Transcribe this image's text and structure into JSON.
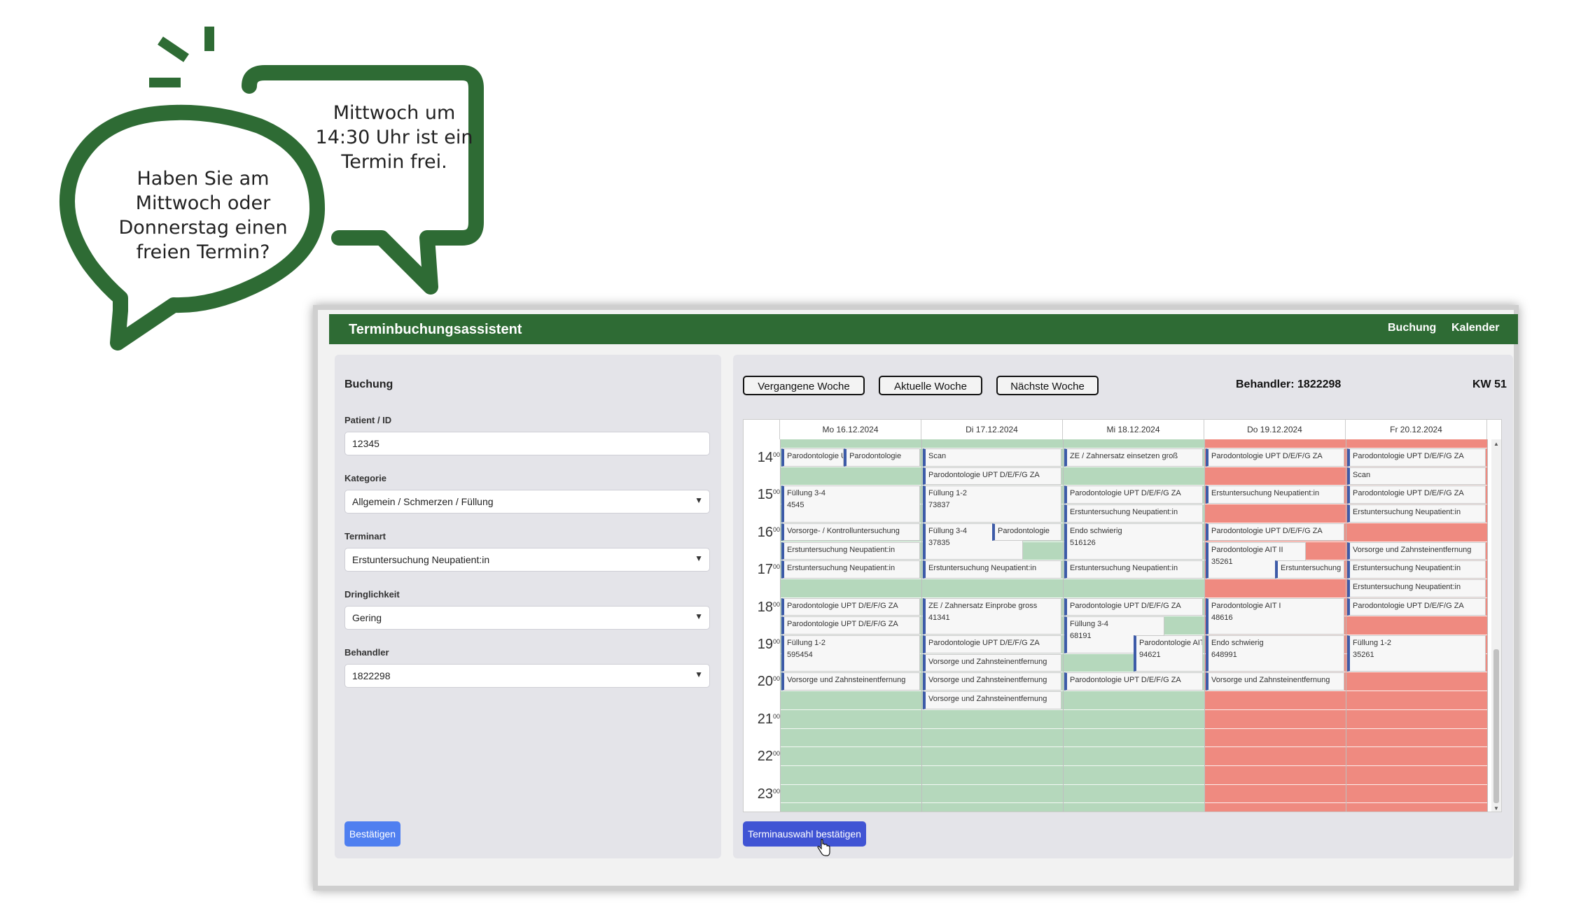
{
  "bubbles": {
    "question": "Haben Sie am Mittwoch oder Donnerstag einen freien Termin?",
    "answer": "Mittwoch um 14:30 Uhr ist ein Termin frei.",
    "color": "#2e6b34"
  },
  "navbar": {
    "title": "Terminbuchungsassistent",
    "links": [
      "Buchung",
      "Kalender"
    ],
    "color": "#2e6b34"
  },
  "booking": {
    "title": "Buchung",
    "fields": [
      {
        "label": "Patient / ID",
        "value": "12345",
        "type": "input"
      },
      {
        "label": "Kategorie",
        "value": "Allgemein / Schmerzen / Füllung",
        "type": "select"
      },
      {
        "label": "Terminart",
        "value": "Erstuntersuchung Neupatient:in",
        "type": "select"
      },
      {
        "label": "Dringlichkeit",
        "value": "Gering",
        "type": "select"
      },
      {
        "label": "Behandler",
        "value": "1822298",
        "type": "select"
      }
    ],
    "confirm": "Bestätigen"
  },
  "calendar": {
    "buttons": [
      "Vergangene Woche",
      "Aktuelle Woche",
      "Nächste Woche"
    ],
    "behandler": "Behandler: 1822298",
    "kw": "KW 51",
    "days": [
      "Mo 16.12.2024",
      "Di 17.12.2024",
      "Mi 18.12.2024",
      "Do 19.12.2024",
      "Fr 20.12.2024"
    ],
    "day_status": [
      "free",
      "free",
      "free",
      "busy",
      "busy"
    ],
    "hours": [
      "14",
      "15",
      "16",
      "17",
      "18",
      "19",
      "20",
      "21",
      "22",
      "23"
    ],
    "minute_sup": "00",
    "confirm": "Terminauswahl bestätigen",
    "events": [
      {
        "day": 0,
        "slot": 0,
        "span": 1,
        "sub": 0,
        "subw": 0.45,
        "text": "Parodontologie UPT D/E/F/G ZA",
        "sub2": ""
      },
      {
        "day": 0,
        "slot": 0,
        "span": 1,
        "sub": 0.45,
        "subw": 0.55,
        "text": "Parodontologie",
        "sub2": ""
      },
      {
        "day": 0,
        "slot": 2,
        "span": 2,
        "sub": 0,
        "subw": 1,
        "text": "Füllung 3-4",
        "sub2": "4545"
      },
      {
        "day": 0,
        "slot": 4,
        "span": 1,
        "sub": 0,
        "subw": 1,
        "text": "Vorsorge- / Kontrolluntersuchung",
        "sub2": ""
      },
      {
        "day": 0,
        "slot": 5,
        "span": 1,
        "sub": 0,
        "subw": 1,
        "text": "Erstuntersuchung Neupatient:in",
        "sub2": ""
      },
      {
        "day": 0,
        "slot": 6,
        "span": 1,
        "sub": 0,
        "subw": 1,
        "text": "Erstuntersuchung Neupatient:in",
        "sub2": ""
      },
      {
        "day": 0,
        "slot": 8,
        "span": 1,
        "sub": 0,
        "subw": 1,
        "text": "Parodontologie UPT D/E/F/G ZA",
        "sub2": ""
      },
      {
        "day": 0,
        "slot": 9,
        "span": 1,
        "sub": 0,
        "subw": 1,
        "text": "Parodontologie UPT D/E/F/G ZA",
        "sub2": ""
      },
      {
        "day": 0,
        "slot": 10,
        "span": 2,
        "sub": 0,
        "subw": 1,
        "text": "Füllung 1-2",
        "sub2": "595454"
      },
      {
        "day": 0,
        "slot": 12,
        "span": 1,
        "sub": 0,
        "subw": 1,
        "text": "Vorsorge und Zahnsteinentfernung",
        "sub2": ""
      },
      {
        "day": 1,
        "slot": 0,
        "span": 1,
        "sub": 0,
        "subw": 1,
        "text": "Scan",
        "sub2": ""
      },
      {
        "day": 1,
        "slot": 1,
        "span": 1,
        "sub": 0,
        "subw": 1,
        "text": "Parodontologie UPT D/E/F/G ZA",
        "sub2": ""
      },
      {
        "day": 1,
        "slot": 2,
        "span": 2,
        "sub": 0,
        "subw": 1,
        "text": "Füllung 1-2",
        "sub2": "73837"
      },
      {
        "day": 1,
        "slot": 4,
        "span": 2,
        "sub": 0,
        "subw": 0.72,
        "text": "Füllung 3-4",
        "sub2": "37835"
      },
      {
        "day": 1,
        "slot": 4,
        "span": 1,
        "sub": 0.5,
        "subw": 0.5,
        "text": "Parodontologie",
        "sub2": ""
      },
      {
        "day": 1,
        "slot": 6,
        "span": 1,
        "sub": 0,
        "subw": 1,
        "text": "Erstuntersuchung Neupatient:in",
        "sub2": ""
      },
      {
        "day": 1,
        "slot": 8,
        "span": 2,
        "sub": 0,
        "subw": 1,
        "text": "ZE / Zahnersatz Einprobe gross",
        "sub2": "41341"
      },
      {
        "day": 1,
        "slot": 10,
        "span": 1,
        "sub": 0,
        "subw": 1,
        "text": "Parodontologie UPT D/E/F/G ZA",
        "sub2": ""
      },
      {
        "day": 1,
        "slot": 11,
        "span": 1,
        "sub": 0,
        "subw": 1,
        "text": "Vorsorge und Zahnsteinentfernung",
        "sub2": ""
      },
      {
        "day": 1,
        "slot": 12,
        "span": 1,
        "sub": 0,
        "subw": 1,
        "text": "Vorsorge und Zahnsteinentfernung",
        "sub2": ""
      },
      {
        "day": 1,
        "slot": 13,
        "span": 1,
        "sub": 0,
        "subw": 1,
        "text": "Vorsorge und Zahnsteinentfernung",
        "sub2": ""
      },
      {
        "day": 2,
        "slot": 0,
        "span": 1,
        "sub": 0,
        "subw": 1,
        "text": "ZE / Zahnersatz einsetzen groß",
        "sub2": ""
      },
      {
        "day": 2,
        "slot": 2,
        "span": 1,
        "sub": 0,
        "subw": 1,
        "text": "Parodontologie UPT D/E/F/G ZA",
        "sub2": ""
      },
      {
        "day": 2,
        "slot": 3,
        "span": 1,
        "sub": 0,
        "subw": 1,
        "text": "Erstuntersuchung Neupatient:in",
        "sub2": ""
      },
      {
        "day": 2,
        "slot": 4,
        "span": 2,
        "sub": 0,
        "subw": 1,
        "text": "Endo schwierig",
        "sub2": "516126"
      },
      {
        "day": 2,
        "slot": 6,
        "span": 1,
        "sub": 0,
        "subw": 1,
        "text": "Erstuntersuchung Neupatient:in",
        "sub2": ""
      },
      {
        "day": 2,
        "slot": 8,
        "span": 1,
        "sub": 0,
        "subw": 1,
        "text": "Parodontologie UPT D/E/F/G ZA",
        "sub2": ""
      },
      {
        "day": 2,
        "slot": 9,
        "span": 2,
        "sub": 0,
        "subw": 0.72,
        "text": "Füllung 3-4",
        "sub2": "68191"
      },
      {
        "day": 2,
        "slot": 10,
        "span": 2,
        "sub": 0.5,
        "subw": 0.5,
        "text": "Parodontologie AIT I",
        "sub2": "94621"
      },
      {
        "day": 2,
        "slot": 12,
        "span": 1,
        "sub": 0,
        "subw": 1,
        "text": "Parodontologie UPT D/E/F/G ZA",
        "sub2": ""
      },
      {
        "day": 3,
        "slot": 0,
        "span": 1,
        "sub": 0,
        "subw": 1,
        "text": "Parodontologie UPT D/E/F/G ZA",
        "sub2": ""
      },
      {
        "day": 3,
        "slot": 2,
        "span": 1,
        "sub": 0,
        "subw": 1,
        "text": "Erstuntersuchung Neupatient:in",
        "sub2": ""
      },
      {
        "day": 3,
        "slot": 4,
        "span": 1,
        "sub": 0,
        "subw": 1,
        "text": "Parodontologie UPT D/E/F/G ZA",
        "sub2": ""
      },
      {
        "day": 3,
        "slot": 5,
        "span": 2,
        "sub": 0,
        "subw": 0.72,
        "text": "Parodontologie AIT II",
        "sub2": "35261"
      },
      {
        "day": 3,
        "slot": 6,
        "span": 1,
        "sub": 0.5,
        "subw": 0.5,
        "text": "Erstuntersuchung Neupatient:in",
        "sub2": ""
      },
      {
        "day": 3,
        "slot": 8,
        "span": 2,
        "sub": 0,
        "subw": 1,
        "text": "Parodontologie AIT I",
        "sub2": "48616"
      },
      {
        "day": 3,
        "slot": 10,
        "span": 2,
        "sub": 0,
        "subw": 1,
        "text": "Endo schwierig",
        "sub2": "648991"
      },
      {
        "day": 3,
        "slot": 12,
        "span": 1,
        "sub": 0,
        "subw": 1,
        "text": "Vorsorge und Zahnsteinentfernung",
        "sub2": ""
      },
      {
        "day": 4,
        "slot": 0,
        "span": 1,
        "sub": 0,
        "subw": 1,
        "text": "Parodontologie UPT D/E/F/G ZA",
        "sub2": ""
      },
      {
        "day": 4,
        "slot": 1,
        "span": 1,
        "sub": 0,
        "subw": 1,
        "text": "Scan",
        "sub2": ""
      },
      {
        "day": 4,
        "slot": 2,
        "span": 1,
        "sub": 0,
        "subw": 1,
        "text": "Parodontologie UPT D/E/F/G ZA",
        "sub2": ""
      },
      {
        "day": 4,
        "slot": 3,
        "span": 1,
        "sub": 0,
        "subw": 1,
        "text": "Erstuntersuchung Neupatient:in",
        "sub2": ""
      },
      {
        "day": 4,
        "slot": 5,
        "span": 1,
        "sub": 0,
        "subw": 1,
        "text": "Vorsorge und Zahnsteinentfernung",
        "sub2": ""
      },
      {
        "day": 4,
        "slot": 6,
        "span": 1,
        "sub": 0,
        "subw": 1,
        "text": "Erstuntersuchung Neupatient:in",
        "sub2": ""
      },
      {
        "day": 4,
        "slot": 7,
        "span": 1,
        "sub": 0,
        "subw": 1,
        "text": "Erstuntersuchung Neupatient:in",
        "sub2": ""
      },
      {
        "day": 4,
        "slot": 8,
        "span": 1,
        "sub": 0,
        "subw": 1,
        "text": "Parodontologie UPT D/E/F/G ZA",
        "sub2": ""
      },
      {
        "day": 4,
        "slot": 10,
        "span": 2,
        "sub": 0,
        "subw": 1,
        "text": "Füllung 1-2",
        "sub2": "35261"
      }
    ]
  }
}
